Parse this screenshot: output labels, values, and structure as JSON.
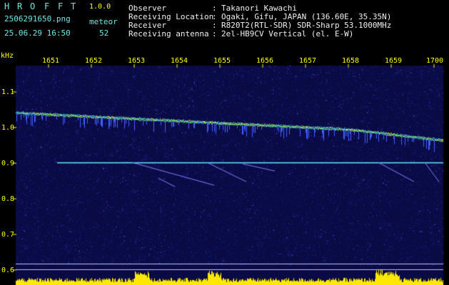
{
  "app": {
    "name_letters": [
      "H",
      "R",
      "O",
      "F",
      "F",
      "T"
    ],
    "version": "1.0.0"
  },
  "file": {
    "filename": "2506291650.png",
    "datetime": "25.06.29 16:50"
  },
  "meteor": {
    "label": "meteor",
    "count": "52"
  },
  "info": [
    {
      "key": "Observer",
      "sep": ":",
      "value": "Takanori Kawachi"
    },
    {
      "key": "Receiving Location",
      "sep": ":",
      "value": "Ogaki, Gifu, JAPAN (136.60E, 35.35N)"
    },
    {
      "key": "Receiver",
      "sep": ":",
      "value": "R820T2(RTL-SDR) SDR-Sharp 53.1000MHz"
    },
    {
      "key": "Receiving antenna",
      "sep": ":",
      "value": "2el-HB9CV Vertical (el. E-W)"
    }
  ],
  "axis": {
    "y_unit": "kHz",
    "y_ticks": [
      "1.1",
      "1.0",
      "0.9",
      "0.8",
      "0.7",
      "0.6"
    ],
    "x_ticks": [
      "1651",
      "1652",
      "1653",
      "1654",
      "1655",
      "1656",
      "1657",
      "1658",
      "1659",
      "1700"
    ]
  },
  "colors": {
    "background": "#000000",
    "spectrogram_bg": "#0a0a44",
    "header_text": "#6fe6e6",
    "title_text": "#ffff00",
    "gridline": "#2a3f9c",
    "carrier_line": "#5ff0ff",
    "level_bar": "#ffe800"
  }
}
